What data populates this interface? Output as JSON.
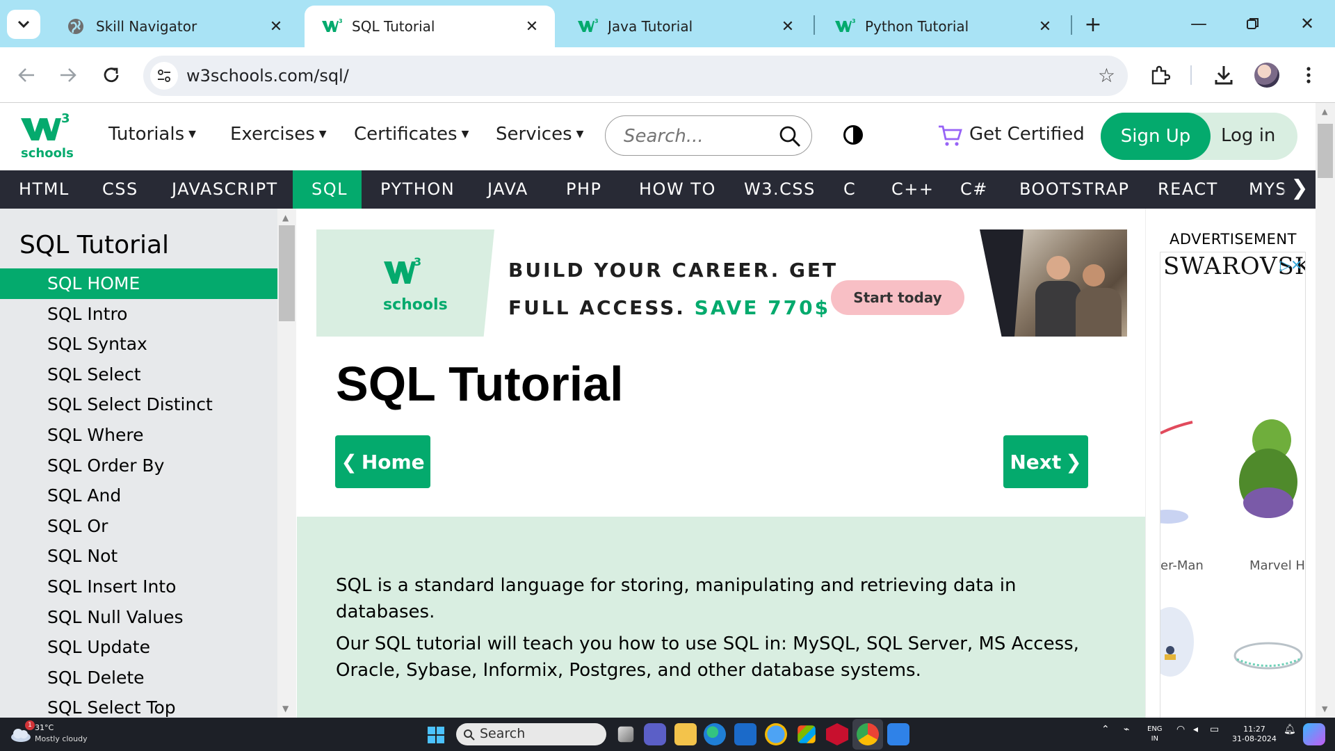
{
  "browser": {
    "tabs": [
      {
        "title": "Skill Navigator",
        "active": false
      },
      {
        "title": "SQL Tutorial",
        "active": true
      },
      {
        "title": "Java Tutorial",
        "active": false
      },
      {
        "title": "Python Tutorial",
        "active": false
      }
    ],
    "url": "w3schools.com/sql/"
  },
  "site": {
    "logo_text": "schools",
    "logo_sup": "3",
    "top_menu": [
      "Tutorials",
      "Exercises",
      "Certificates",
      "Services"
    ],
    "search_placeholder": "Search...",
    "get_certified": "Get Certified",
    "sign_up": "Sign Up",
    "log_in": "Log in",
    "subjects": [
      "HTML",
      "CSS",
      "JAVASCRIPT",
      "SQL",
      "PYTHON",
      "JAVA",
      "PHP",
      "HOW TO",
      "W3.CSS",
      "C",
      "C++",
      "C#",
      "BOOTSTRAP",
      "REACT",
      "MYS"
    ],
    "active_subject": "SQL",
    "accent": "#04aa6d",
    "nav_dark": "#282a35"
  },
  "sidebar": {
    "title": "SQL Tutorial",
    "items": [
      "SQL HOME",
      "SQL Intro",
      "SQL Syntax",
      "SQL Select",
      "SQL Select Distinct",
      "SQL Where",
      "SQL Order By",
      "SQL And",
      "SQL Or",
      "SQL Not",
      "SQL Insert Into",
      "SQL Null Values",
      "SQL Update",
      "SQL Delete",
      "SQL Select Top"
    ],
    "active_index": 0
  },
  "banner": {
    "brand": "schools",
    "line1": "BUILD YOUR CAREER. GET",
    "line2_prefix": "FULL ACCESS. ",
    "line2_save": "SAVE 770$",
    "cta": "Start today"
  },
  "main": {
    "title": "SQL Tutorial",
    "home_button": "Home",
    "next_button": "Next",
    "paragraphs": [
      "SQL is a standard language for storing, manipulating and retrieving data in databases.",
      "Our SQL tutorial will teach you how to use SQL in: MySQL, SQL Server, MS Access, Oracle, Sybase, Informix, Postgres, and other database systems."
    ]
  },
  "ad": {
    "label": "ADVERTISEMENT",
    "brand": "SWAROVSKI",
    "captions": [
      "er-Man",
      "Marvel H"
    ]
  },
  "taskbar": {
    "weather_temp": "31°C",
    "weather_desc": "Mostly cloudy",
    "weather_badge": "1",
    "search": "Search",
    "lang": "ENG",
    "region": "IN",
    "time": "11:27",
    "date": "31-08-2024"
  }
}
